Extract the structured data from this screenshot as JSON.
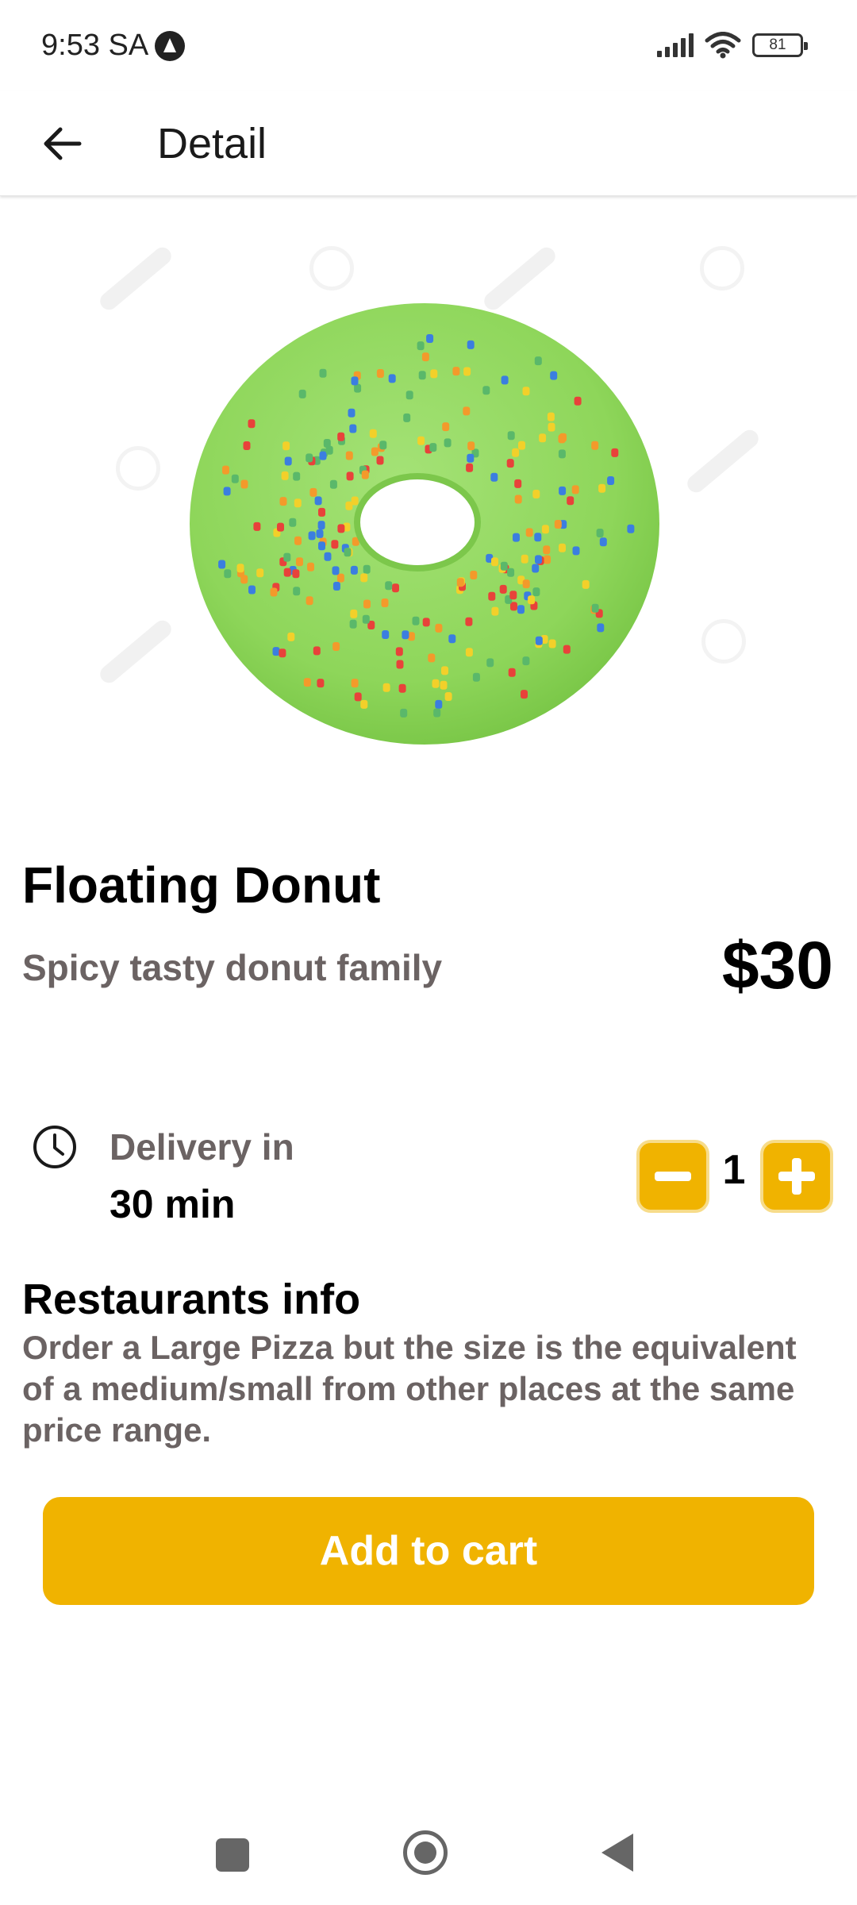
{
  "status_bar": {
    "time": "9:53 SA",
    "battery": "81",
    "icons": [
      "app-notification-icon",
      "signal-icon",
      "wifi-icon",
      "battery-icon"
    ]
  },
  "app_bar": {
    "title": "Detail",
    "back_icon": "arrow-left-icon"
  },
  "product": {
    "image": "green-sprinkled-donut",
    "name": "Floating Donut",
    "subtitle": "Spicy tasty donut family",
    "price": "$30"
  },
  "delivery": {
    "icon": "clock-icon",
    "label": "Delivery in",
    "time": "30 min"
  },
  "quantity": {
    "value": "1",
    "decrement_icon": "minus-icon",
    "increment_icon": "plus-icon"
  },
  "restaurant_info": {
    "title": "Restaurants info",
    "body": "Order a Large Pizza but the size is the equivalent of a medium/small from other places at the same price range."
  },
  "cta": {
    "label": "Add to cart"
  },
  "nav_bar": {
    "icons": [
      "recent-apps-icon",
      "home-icon",
      "back-triangle-icon"
    ]
  },
  "colors": {
    "accent": "#f0b300",
    "muted_text": "#6b6363",
    "donut_glaze": "#8ed65a"
  }
}
